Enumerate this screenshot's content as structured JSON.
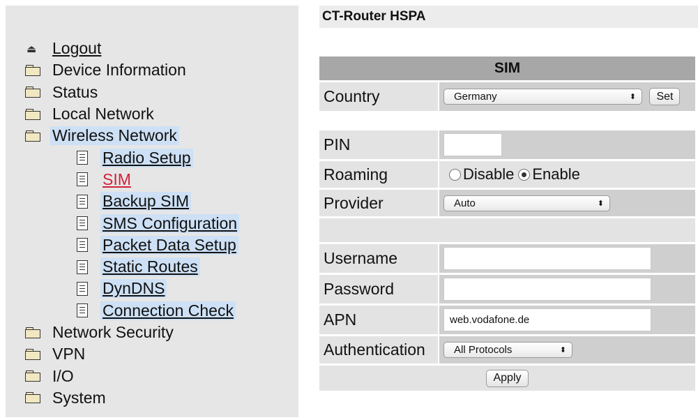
{
  "nav": {
    "items": [
      {
        "label": "Logout",
        "icon": "logout-icon"
      },
      {
        "label": "Device Information",
        "icon": "folder-icon"
      },
      {
        "label": "Status",
        "icon": "folder-icon"
      },
      {
        "label": "Local Network",
        "icon": "folder-icon"
      },
      {
        "label": "Wireless Network",
        "icon": "folder-icon",
        "children": [
          {
            "label": "Radio Setup"
          },
          {
            "label": "SIM"
          },
          {
            "label": "Backup SIM"
          },
          {
            "label": "SMS Configuration"
          },
          {
            "label": "Packet Data Setup"
          },
          {
            "label": "Static Routes"
          },
          {
            "label": "DynDNS"
          },
          {
            "label": "Connection Check"
          }
        ]
      },
      {
        "label": "Network Security",
        "icon": "folder-icon"
      },
      {
        "label": "VPN",
        "icon": "folder-icon"
      },
      {
        "label": "I/O",
        "icon": "folder-icon"
      },
      {
        "label": "System",
        "icon": "folder-icon"
      }
    ],
    "active_color": "#d0223a",
    "highlight_color": "#cde0f5"
  },
  "header": {
    "title": "CT-Router HSPA"
  },
  "sim": {
    "section_title": "SIM",
    "country": {
      "label": "Country",
      "value": "Germany",
      "set_button": "Set"
    },
    "pin": {
      "label": "PIN",
      "value": ""
    },
    "roaming": {
      "label": "Roaming",
      "options": [
        "Disable",
        "Enable"
      ],
      "selected": "Enable"
    },
    "provider": {
      "label": "Provider",
      "value": "Auto"
    },
    "username": {
      "label": "Username",
      "value": ""
    },
    "password": {
      "label": "Password",
      "value": ""
    },
    "apn": {
      "label": "APN",
      "value": "web.vodafone.de"
    },
    "authentication": {
      "label": "Authentication",
      "value": "All Protocols"
    },
    "apply_button": "Apply"
  }
}
